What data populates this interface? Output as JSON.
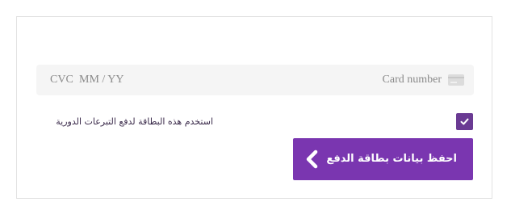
{
  "payment_form": {
    "card_number_placeholder": "Card number",
    "expiry_placeholder": "MM / YY",
    "cvc_placeholder": "CVC",
    "recurring_checkbox": {
      "checked": true,
      "label": "استخدم هذه البطاقة لدفع التبرعات الدورية"
    },
    "save_button": {
      "label": "احفظ بيانات بطاقة الدفع",
      "icon": "chevron-left-icon"
    },
    "colors": {
      "accent": "#7a36b0",
      "checkbox": "#6a3a93",
      "field_background": "#f5f5f5",
      "placeholder": "#8a8a8a"
    }
  }
}
